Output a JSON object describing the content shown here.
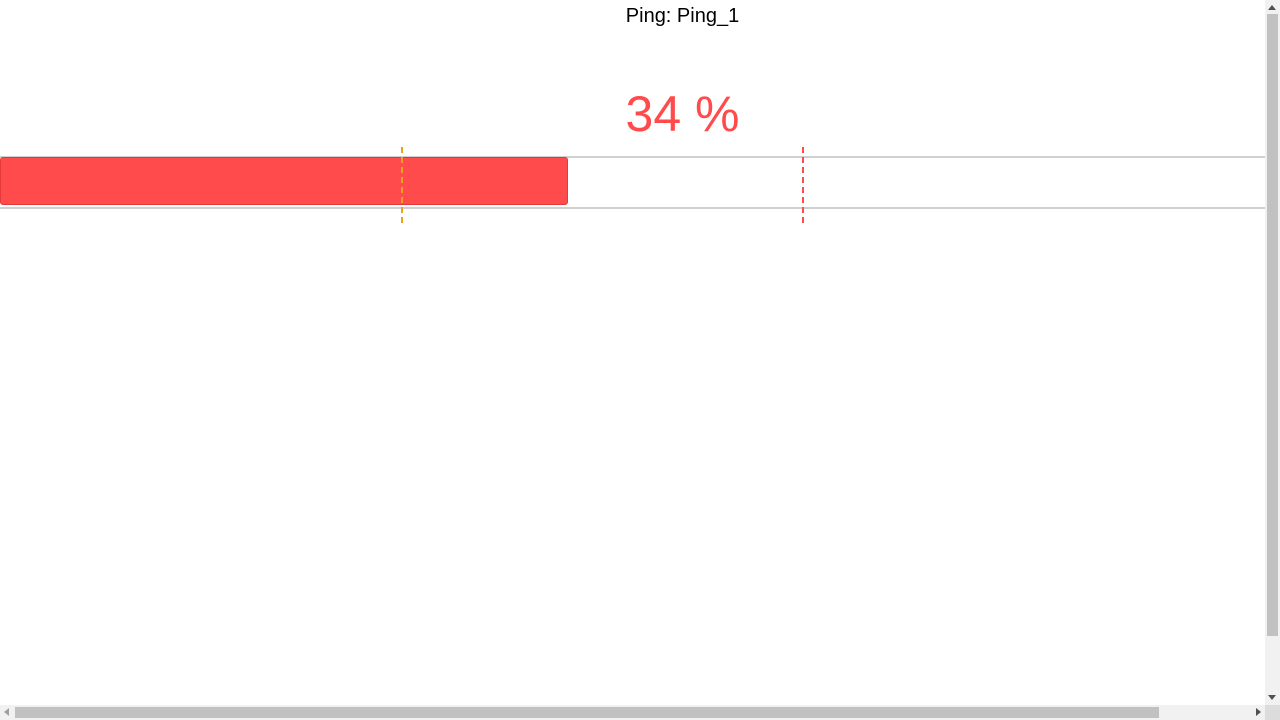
{
  "gauge": {
    "title": "Ping: Ping_1",
    "percent_text": "34 %",
    "value_fraction": 0.45,
    "thresholds": [
      {
        "name": "warning",
        "fraction": 0.3175,
        "color": "#f0a020"
      },
      {
        "name": "critical",
        "fraction": 0.635,
        "color": "#ff4b4b"
      }
    ],
    "colors": {
      "fill": "#ff4b4b",
      "text": "#ff4b4b",
      "track_border": "#d0d0d0"
    }
  },
  "scrollbars": {
    "vertical_icon_up": "triangle-up-icon",
    "vertical_icon_down": "triangle-down-icon",
    "horizontal_icon_left": "triangle-left-icon",
    "horizontal_icon_right": "triangle-right-icon"
  }
}
